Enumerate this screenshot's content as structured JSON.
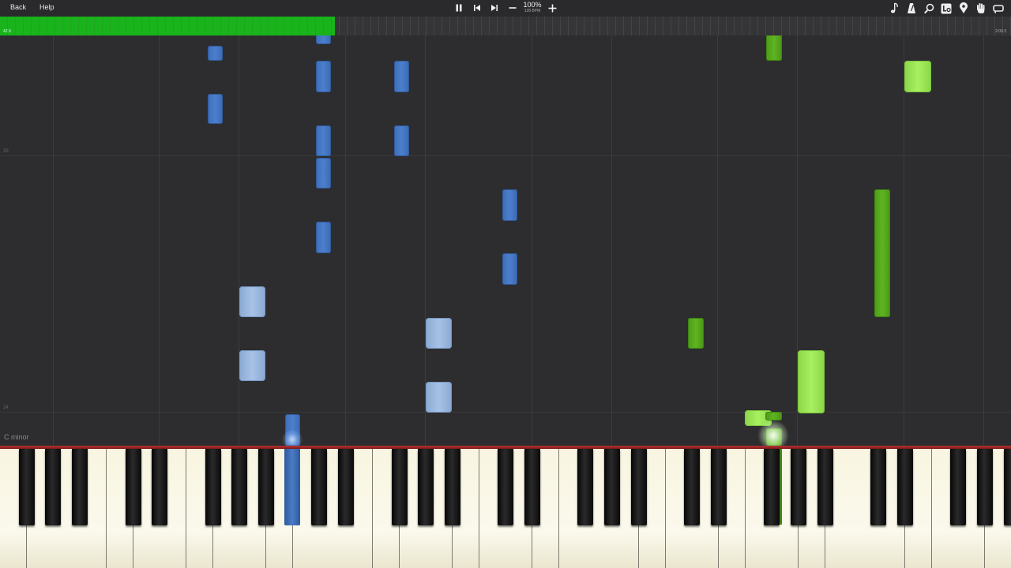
{
  "toolbar": {
    "back_label": "Back",
    "help_label": "Help",
    "tempo_percent": "100%",
    "tempo_bpm": "128 BPM"
  },
  "progress": {
    "current": "42.9",
    "total": "2:09.3",
    "fraction": 0.331
  },
  "roll": {
    "measure_labels": [
      "25",
      "24"
    ]
  },
  "scale_label": "C minor",
  "colors": {
    "left_hand_dark": "#4a7cc6",
    "left_hand_light": "#a3bfe3",
    "right_hand_dark": "#56a81d",
    "right_hand_light": "#a4ec5c",
    "progress": "#19b31b",
    "keyboard_rim": "#b83232"
  },
  "icons": {
    "controls": [
      "pause-icon",
      "skip-back-icon",
      "skip-forward-icon",
      "minus-icon",
      "plus-icon"
    ],
    "right": [
      "music-note-icon",
      "metronome-icon",
      "magnifier-icon",
      "label-icon",
      "location-pin-icon",
      "hand-icon",
      "loop-icon"
    ]
  }
}
